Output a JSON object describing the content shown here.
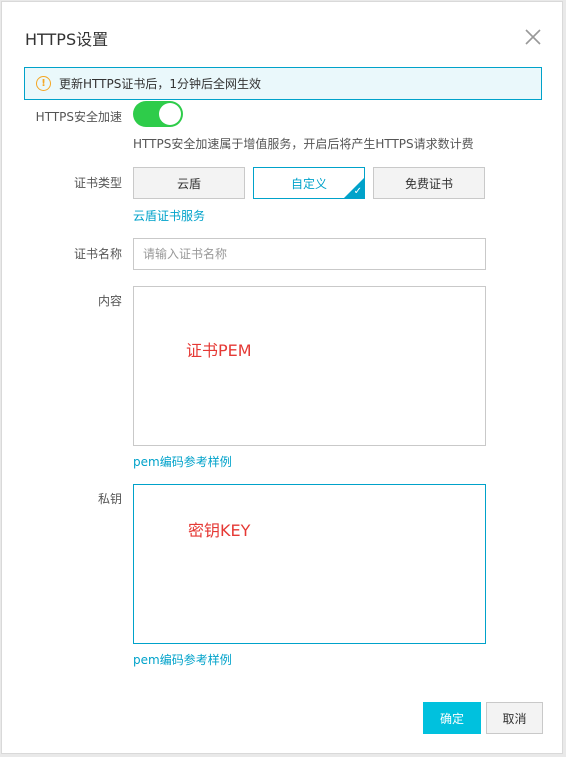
{
  "dialog": {
    "title": "HTTPS设置",
    "close_icon": "close-icon"
  },
  "notice": {
    "icon": "warning-icon",
    "text": "更新HTTPS证书后，1分钟后全网生效"
  },
  "https_acceleration": {
    "label": "HTTPS安全加速",
    "enabled": true,
    "hint": "HTTPS安全加速属于增值服务，开启后将产生HTTPS请求数计费"
  },
  "cert_type": {
    "label": "证书类型",
    "options": [
      "云盾",
      "自定义",
      "免费证书"
    ],
    "selected": "自定义",
    "link": "云盾证书服务"
  },
  "cert_name": {
    "label": "证书名称",
    "placeholder": "请输入证书名称",
    "value": ""
  },
  "content": {
    "label": "内容",
    "annotation": "证书PEM",
    "link": "pem编码参考样例"
  },
  "private_key": {
    "label": "私钥",
    "annotation": "密钥KEY",
    "link": "pem编码参考样例"
  },
  "footer": {
    "confirm": "确定",
    "cancel": "取消"
  },
  "colors": {
    "accent": "#00a2ca",
    "primary_button": "#00c1de",
    "toggle_on": "#2ecc4a",
    "annotation": "#e53935",
    "warning": "#f5a623"
  }
}
